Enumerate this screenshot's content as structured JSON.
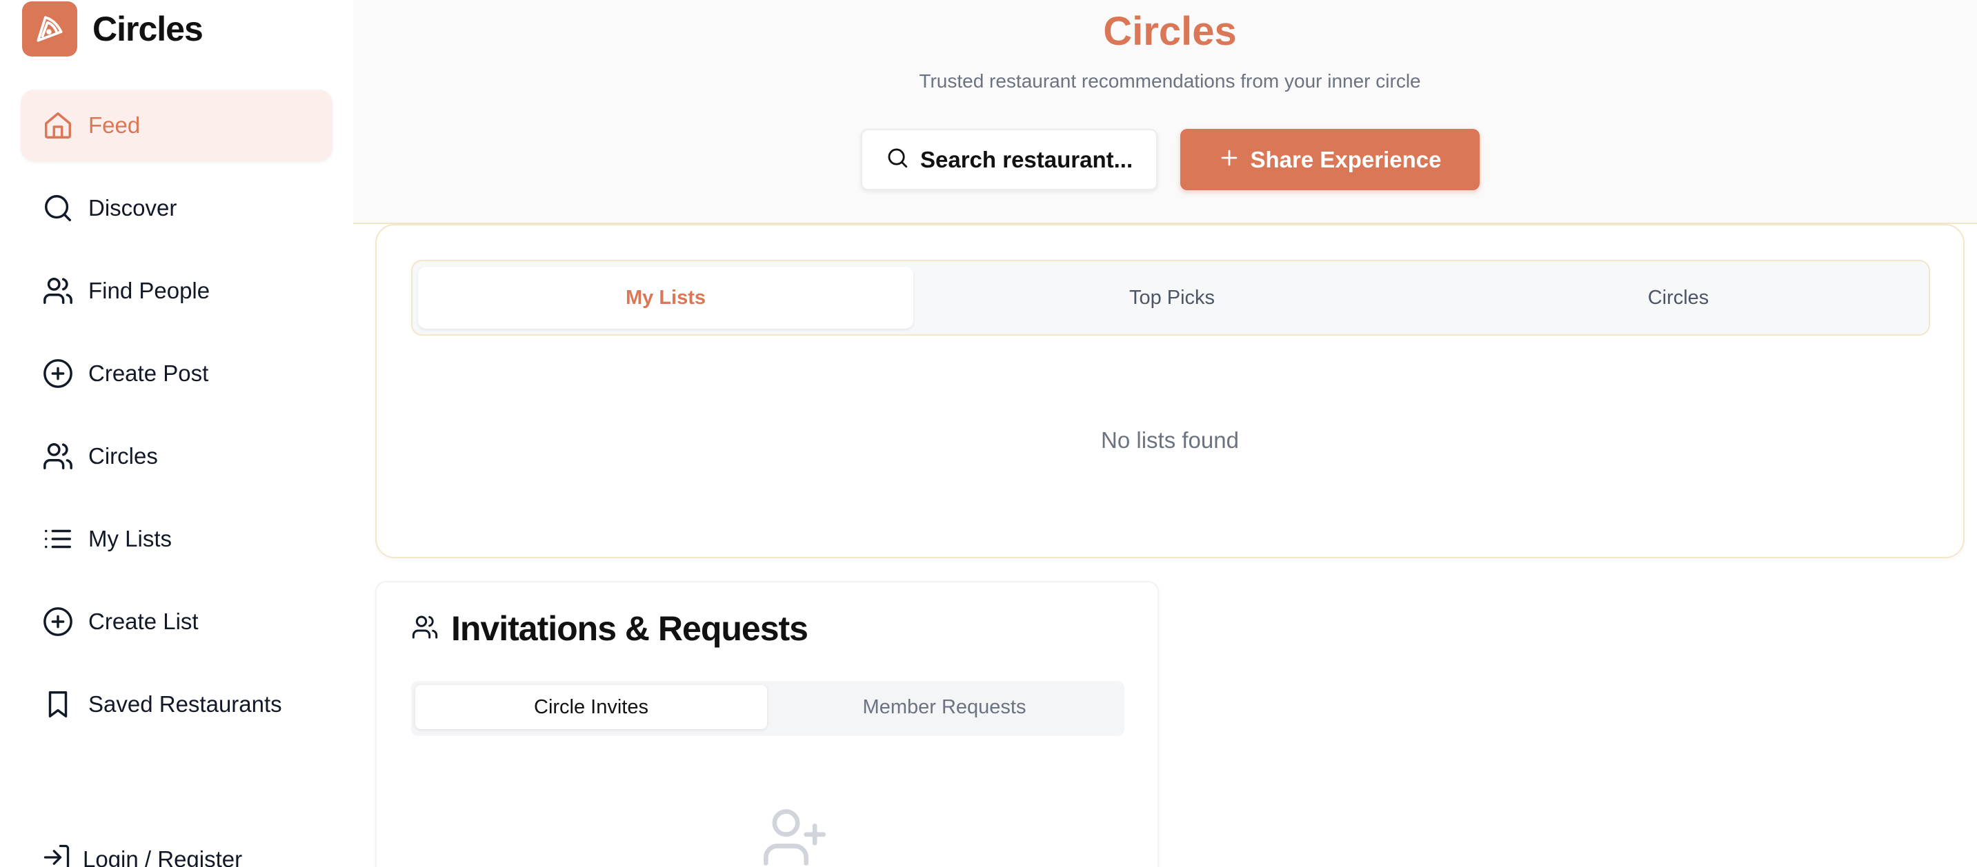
{
  "sidebar": {
    "brand": {
      "name": "Circles",
      "logo_icon": "pizza-slice-icon"
    },
    "items": [
      {
        "label": "Feed",
        "icon": "home-icon",
        "active": true
      },
      {
        "label": "Discover",
        "icon": "search-icon"
      },
      {
        "label": "Find People",
        "icon": "users-icon"
      },
      {
        "label": "Create Post",
        "icon": "plus-circle-icon"
      },
      {
        "label": "Circles",
        "icon": "users-icon"
      },
      {
        "label": "My Lists",
        "icon": "list-icon"
      },
      {
        "label": "Create List",
        "icon": "plus-circle-icon"
      },
      {
        "label": "Saved Restaurants",
        "icon": "bookmark-icon"
      }
    ],
    "login": {
      "label": "Login / Register",
      "icon": "login-icon"
    }
  },
  "header": {
    "title": "Circles",
    "subtitle": "Trusted restaurant recommendations from your inner circle",
    "search_button": "Search restaurant...",
    "share_button": "Share Experience"
  },
  "lists": {
    "tabs": [
      "My Lists",
      "Top Picks",
      "Circles"
    ],
    "active_tab": "My Lists",
    "empty_text": "No lists found"
  },
  "invitations": {
    "title": "Invitations & Requests",
    "tabs": [
      "Circle Invites",
      "Member Requests"
    ],
    "active_tab": "Circle Invites"
  },
  "colors": {
    "accent": "#d97757",
    "accent_soft": "#fcefeb",
    "border": "#f3e7c9",
    "muted_text": "#6b7280"
  }
}
